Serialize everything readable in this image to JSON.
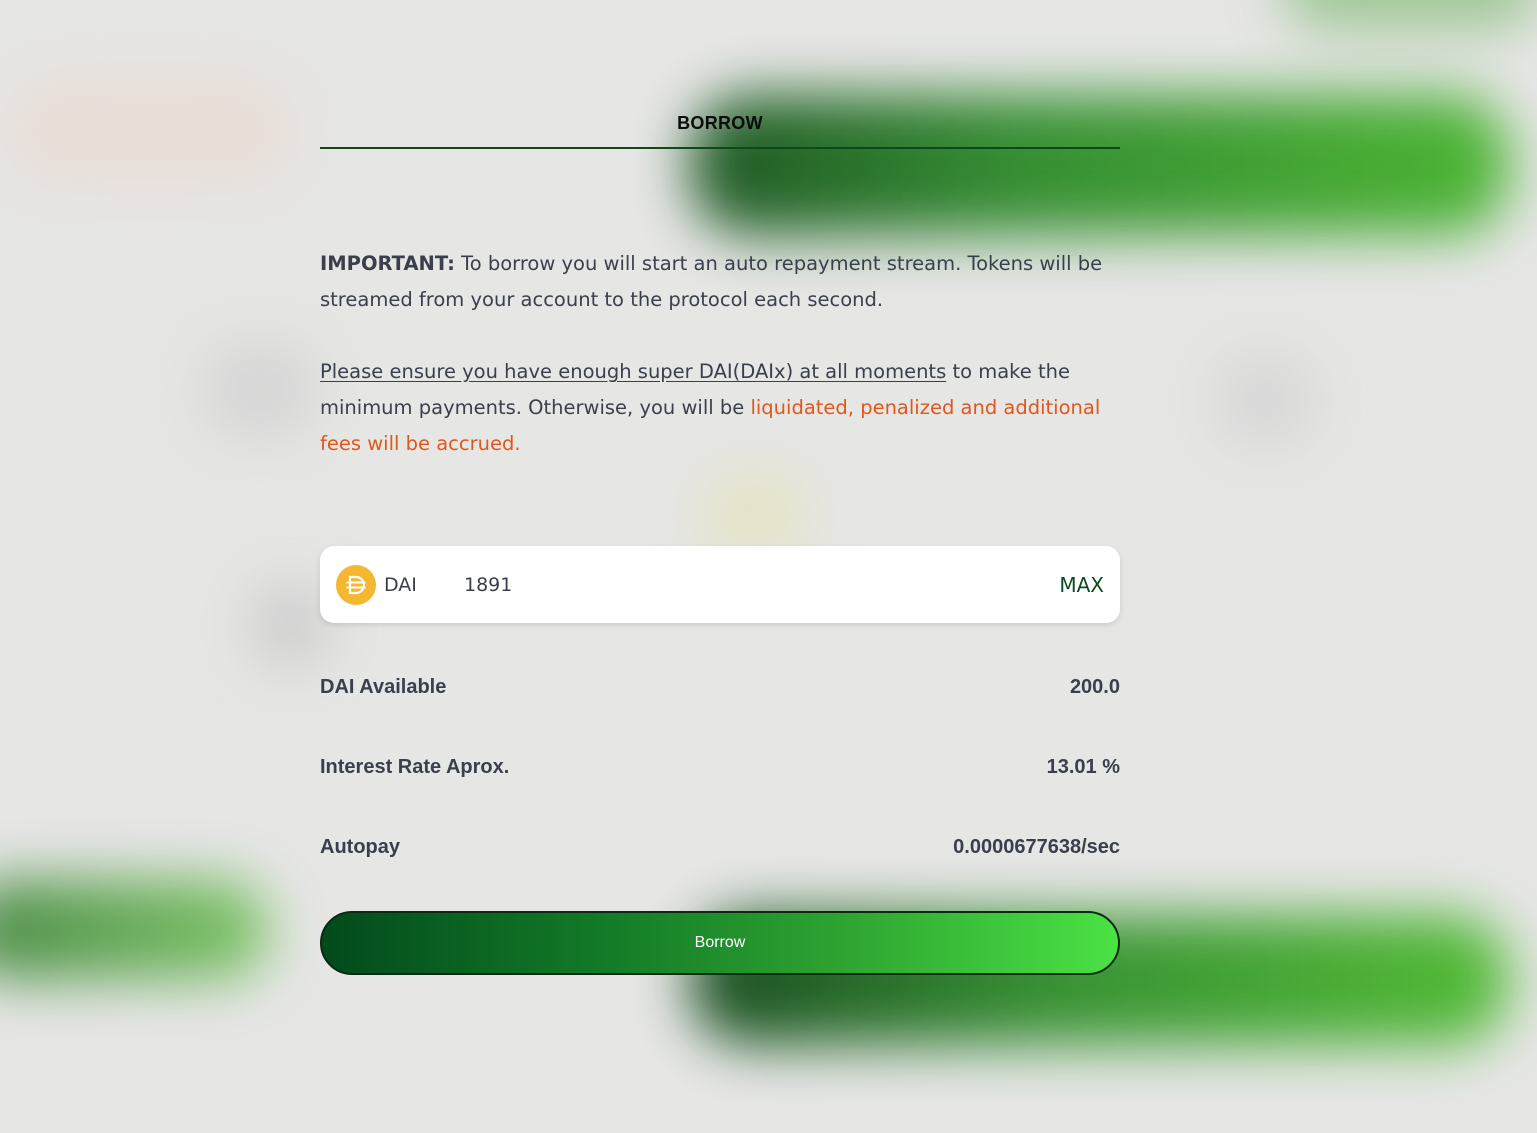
{
  "header": {
    "title": "BORROW"
  },
  "notice": {
    "important_label": "IMPORTANT:",
    "important_text": " To borrow you will start an auto repayment stream. Tokens will be streamed from your account to the protocol each second.",
    "ensure_text": "Please ensure you have enough super DAI(DAIx) at all moments",
    "minimum_text": " to make the minimum payments. Otherwise, you will be ",
    "warning_text": "liquidated, penalized and additional fees will be accrued."
  },
  "amount": {
    "token_icon": "dai-icon",
    "token_symbol": "DAI",
    "value": "1891",
    "max_label": "MAX"
  },
  "info": {
    "available_label": "DAI Available",
    "available_value": "200.0",
    "rate_label": "Interest Rate Aprox.",
    "rate_value": "13.01 %",
    "autopay_label": "Autopay",
    "autopay_value": "0.0000677638/sec"
  },
  "actions": {
    "borrow_label": "Borrow"
  },
  "colors": {
    "accent_green": "#0d4a1c",
    "warning_orange": "#e0571c",
    "dai_yellow": "#f4b731"
  }
}
